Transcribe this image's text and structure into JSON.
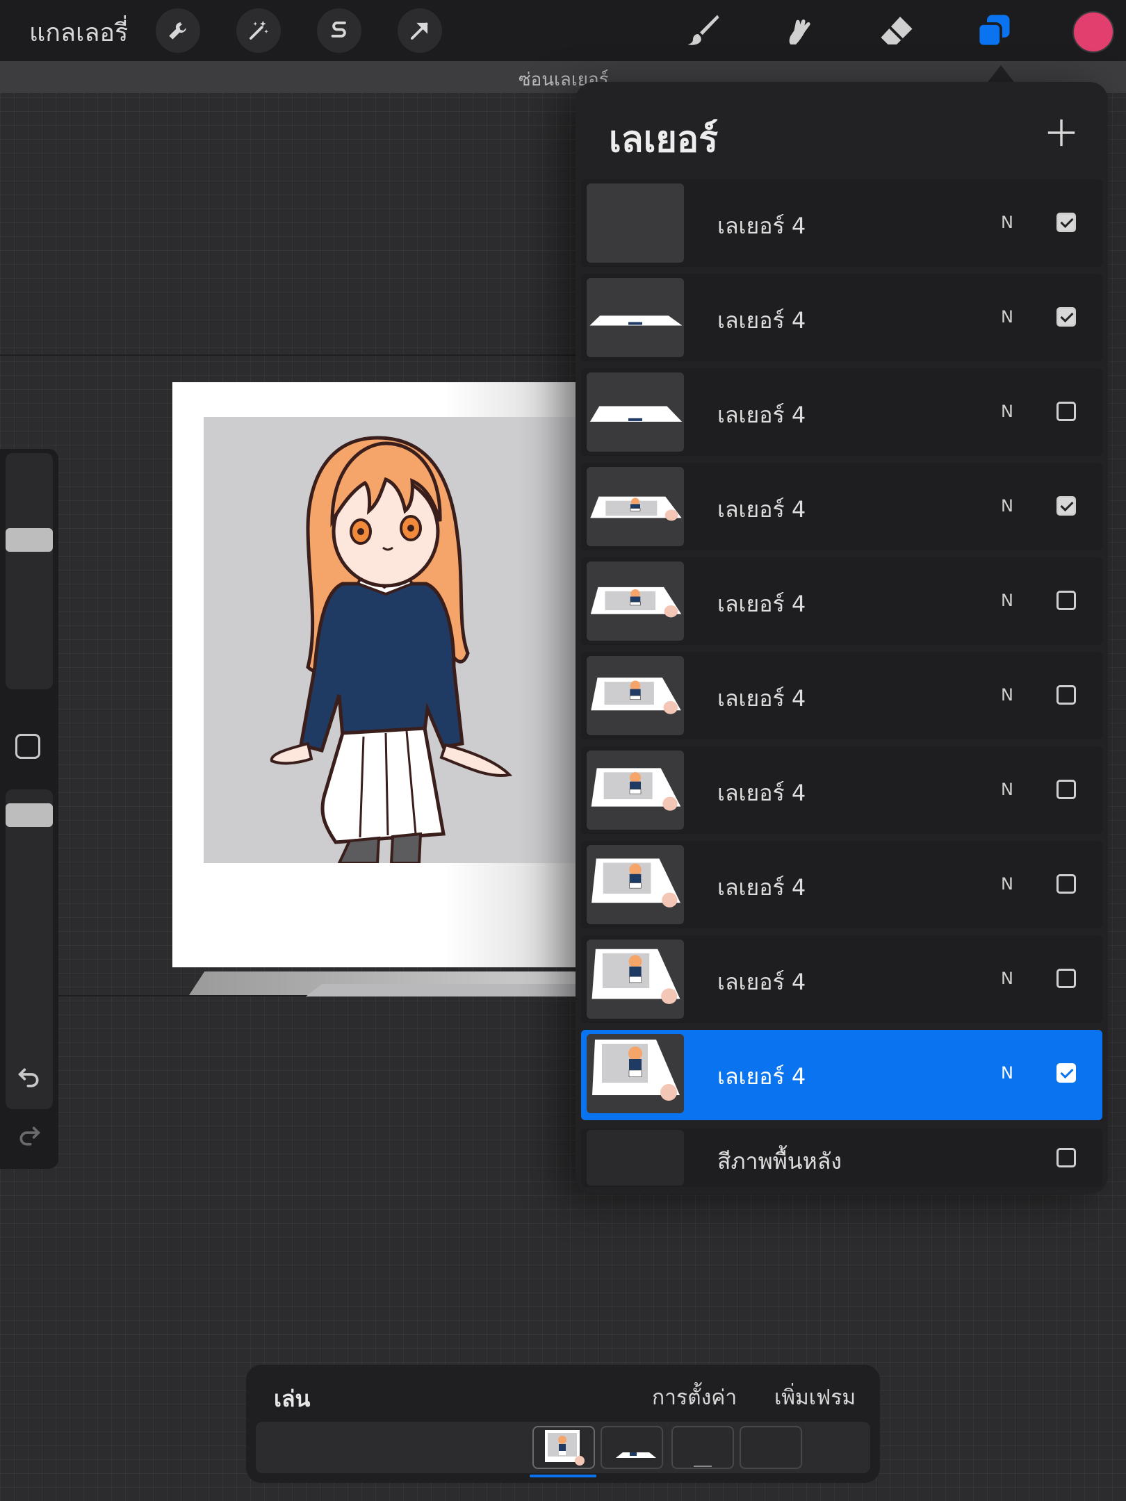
{
  "topbar": {
    "gallery_label": "แกลเลอรี่",
    "tools_left": [
      "wrench-icon",
      "magic-wand-icon",
      "selection-s-icon",
      "transform-arrow-icon"
    ],
    "tools_right": [
      "brush-icon",
      "smudge-icon",
      "eraser-icon",
      "layers-icon"
    ],
    "active_tool": "layers-icon",
    "current_color": "#e23e6e"
  },
  "hide_layers_label": "ซ่อนเลเยอร์",
  "layers_panel": {
    "title": "เลเยอร์",
    "add_icon": "plus-icon",
    "layers": [
      {
        "name": "เลเยอร์ 4",
        "mode": "N",
        "visible": true
      },
      {
        "name": "เลเยอร์ 4",
        "mode": "N",
        "visible": true
      },
      {
        "name": "เลเยอร์ 4",
        "mode": "N",
        "visible": false
      },
      {
        "name": "เลเยอร์ 4",
        "mode": "N",
        "visible": true
      },
      {
        "name": "เลเยอร์ 4",
        "mode": "N",
        "visible": false
      },
      {
        "name": "เลเยอร์ 4",
        "mode": "N",
        "visible": false
      },
      {
        "name": "เลเยอร์ 4",
        "mode": "N",
        "visible": false
      },
      {
        "name": "เลเยอร์ 4",
        "mode": "N",
        "visible": false
      },
      {
        "name": "เลเยอร์ 4",
        "mode": "N",
        "visible": false
      },
      {
        "name": "เลเยอร์ 4",
        "mode": "N",
        "visible": true,
        "selected": true
      }
    ],
    "background": {
      "name": "สีภาพพื้นหลัง",
      "visible": false
    }
  },
  "timeline": {
    "play_label": "เล่น",
    "settings_label": "การตั้งค่า",
    "add_frame_label": "เพิ่มเฟรม",
    "frame_count": 4,
    "selected_frame": 1
  },
  "colors": {
    "accent": "#0a74f0",
    "panel": "#222224",
    "topbar": "#1c1c1e"
  }
}
